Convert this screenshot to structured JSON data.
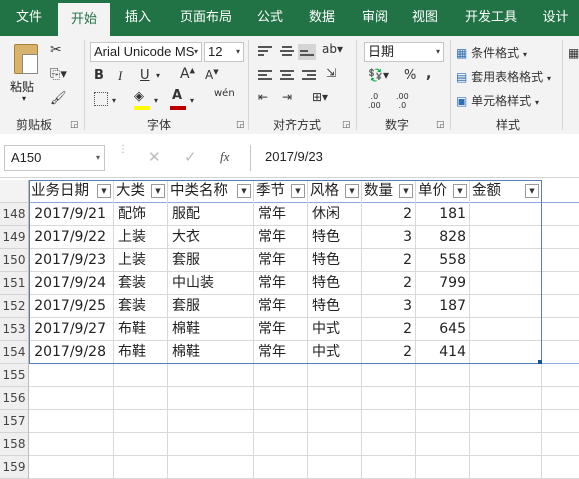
{
  "tabs": [
    "文件",
    "开始",
    "插入",
    "页面布局",
    "公式",
    "数据",
    "审阅",
    "视图",
    "开发工具",
    "设计"
  ],
  "active_tab": "开始",
  "ribbon": {
    "paste_label": "粘贴",
    "clipboard_label": "剪贴板",
    "font_name": "Arial Unicode MS",
    "font_size": "12",
    "font_group_label": "字体",
    "align_group_label": "对齐方式",
    "number_format": "日期",
    "number_group_label": "数字",
    "cond_format": "条件格式",
    "table_format": "套用表格格式",
    "cell_styles": "单元格样式",
    "styles_group_label": "样式",
    "bold": "B",
    "italic": "I",
    "underline": "U",
    "phonetic": "wén"
  },
  "name_box": "A150",
  "formula_value": "2017/9/23",
  "accent_color": "#217346",
  "font_color_bar": "#c00000",
  "fill_color_bar": "#ffff00",
  "grid": {
    "headers": [
      "业务日期",
      "大类",
      "中类名称",
      "季节",
      "风格",
      "数量",
      "单价",
      "金额"
    ],
    "rows": [
      {
        "num": "148",
        "cells": [
          "2017/9/21",
          "配饰",
          "服配",
          "常年",
          "休闲",
          "2",
          "181",
          ""
        ]
      },
      {
        "num": "149",
        "cells": [
          "2017/9/22",
          "上装",
          "大衣",
          "常年",
          "特色",
          "3",
          "828",
          ""
        ]
      },
      {
        "num": "150",
        "cells": [
          "2017/9/23",
          "上装",
          "套服",
          "常年",
          "特色",
          "2",
          "558",
          ""
        ]
      },
      {
        "num": "151",
        "cells": [
          "2017/9/24",
          "套装",
          "中山装",
          "常年",
          "特色",
          "2",
          "799",
          ""
        ]
      },
      {
        "num": "152",
        "cells": [
          "2017/9/25",
          "套装",
          "套服",
          "常年",
          "特色",
          "3",
          "187",
          ""
        ]
      },
      {
        "num": "153",
        "cells": [
          "2017/9/27",
          "布鞋",
          "棉鞋",
          "常年",
          "中式",
          "2",
          "645",
          ""
        ]
      },
      {
        "num": "154",
        "cells": [
          "2017/9/28",
          "布鞋",
          "棉鞋",
          "常年",
          "中式",
          "2",
          "414",
          ""
        ]
      }
    ],
    "empty_rows": [
      "155",
      "156",
      "157",
      "158",
      "159"
    ]
  }
}
